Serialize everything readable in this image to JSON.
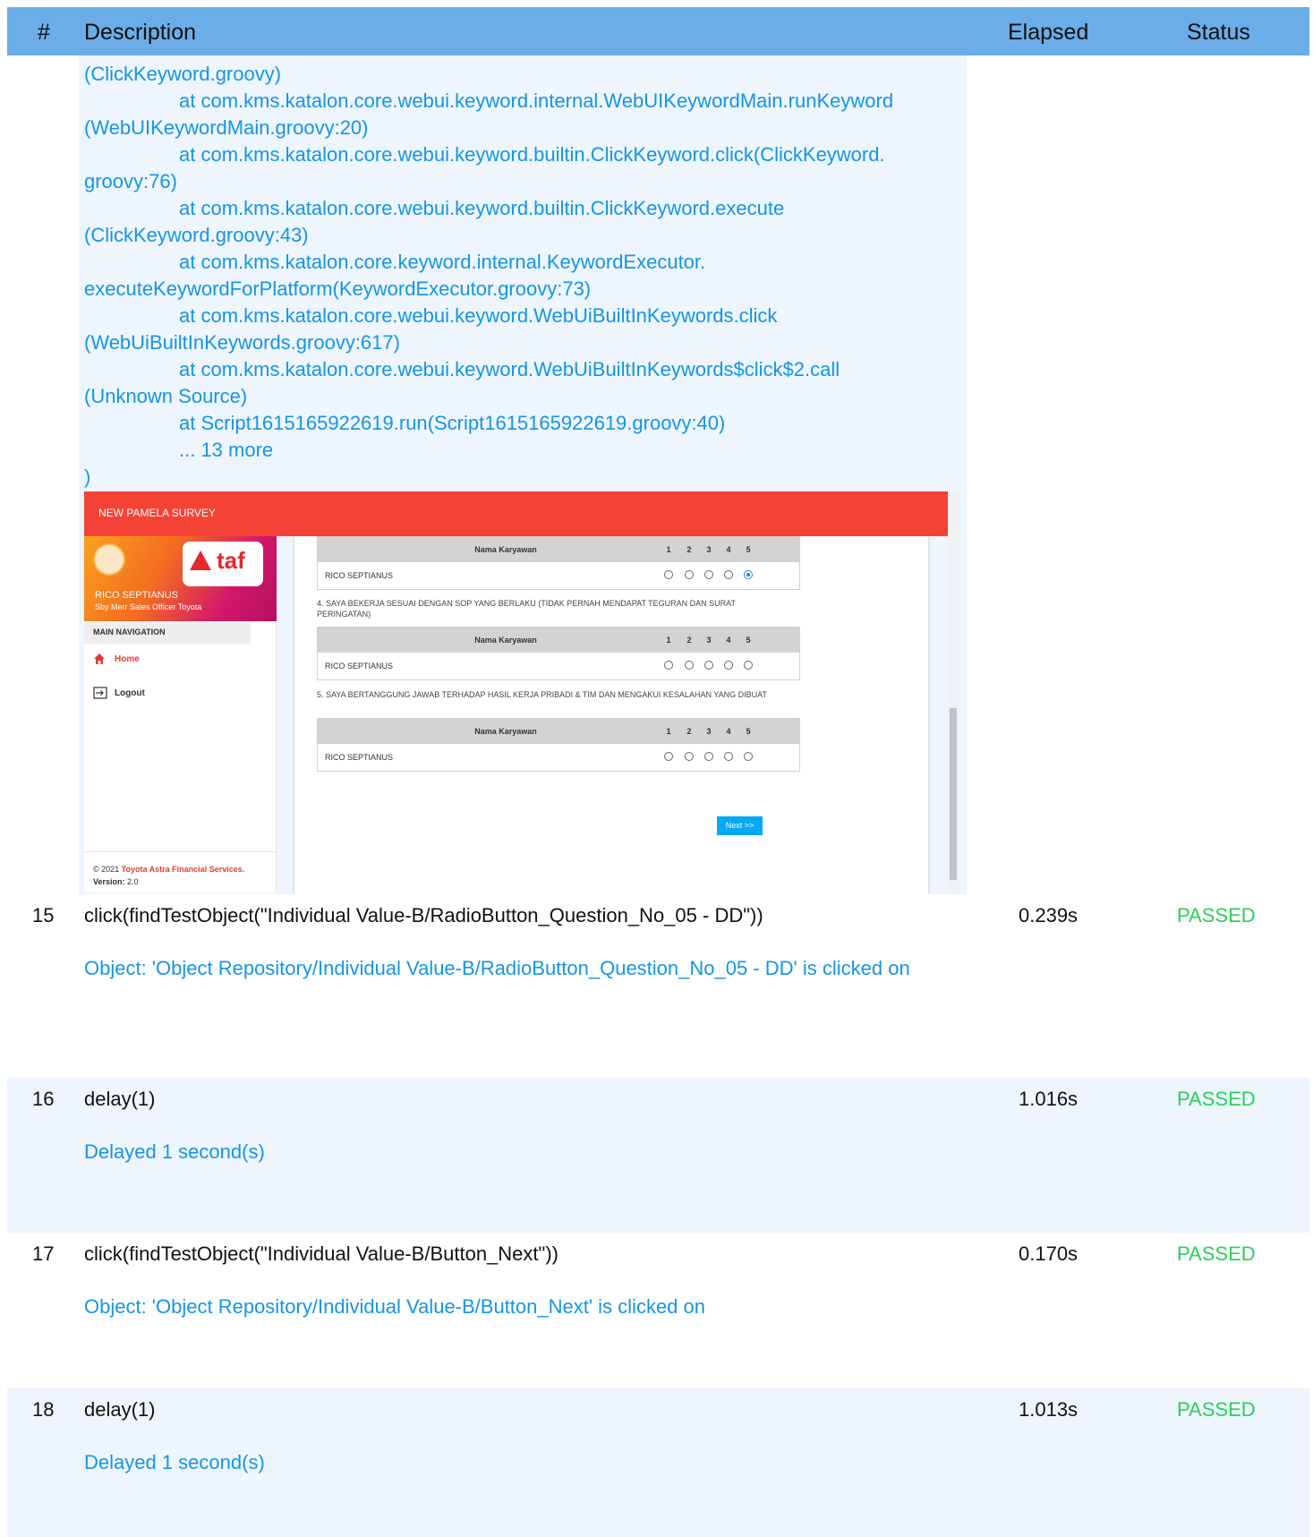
{
  "header": {
    "num": "#",
    "description": "Description",
    "elapsed": "Elapsed",
    "status": "Status"
  },
  "trace": {
    "lines": [
      {
        "text": "(ClickKeyword.groovy)",
        "indent": false
      },
      {
        "text": "at com.kms.katalon.core.webui.keyword.internal.WebUIKeywordMain.runKeyword",
        "indent": true
      },
      {
        "text": "(WebUIKeywordMain.groovy:20)",
        "indent": false
      },
      {
        "text": "at com.kms.katalon.core.webui.keyword.builtin.ClickKeyword.click(ClickKeyword.",
        "indent": true
      },
      {
        "text": "groovy:76)",
        "indent": false
      },
      {
        "text": "at com.kms.katalon.core.webui.keyword.builtin.ClickKeyword.execute",
        "indent": true
      },
      {
        "text": "(ClickKeyword.groovy:43)",
        "indent": false
      },
      {
        "text": "at com.kms.katalon.core.keyword.internal.KeywordExecutor.",
        "indent": true
      },
      {
        "text": "executeKeywordForPlatform(KeywordExecutor.groovy:73)",
        "indent": false
      },
      {
        "text": "at com.kms.katalon.core.webui.keyword.WebUiBuiltInKeywords.click",
        "indent": true
      },
      {
        "text": "(WebUiBuiltInKeywords.groovy:617)",
        "indent": false
      },
      {
        "text": "at com.kms.katalon.core.webui.keyword.WebUiBuiltInKeywords$click$2.call",
        "indent": true
      },
      {
        "text": "(Unknown Source)",
        "indent": false
      },
      {
        "text": "at Script1615165922619.run(Script1615165922619.groovy:40)",
        "indent": true
      },
      {
        "text": "... 13 more",
        "indent": true
      },
      {
        "text": ")",
        "indent": false
      }
    ]
  },
  "screenshot": {
    "title": "NEW PAMELA SURVEY",
    "logo_text": "taf",
    "user_name": "RICO SEPTIANUS",
    "user_role": "Sby Merr Sales Officer Toyota",
    "main_nav": "MAIN NAVIGATION",
    "nav_home": "Home",
    "nav_logout": "Logout",
    "footer_prefix": "© 2021",
    "footer_company": "Toyota Astra Financial Services.",
    "footer_version_label": "Version:",
    "footer_version": "2.0",
    "col_name": "Nama Karyawan",
    "scale": [
      "1",
      "2",
      "3",
      "4",
      "5"
    ],
    "employee": "RICO SEPTIANUS",
    "question_4": "4. SAYA BEKERJA SESUAI DENGAN SOP YANG BERLAKU (TIDAK PERNAH MENDAPAT TEGURAN DAN SURAT PERINGATAN)",
    "question_5": "5. SAYA BERTANGGUNG JAWAB TERHADAP HASIL KERJA PRIBADI & TIM DAN MENGAKUI KESALAHAN YANG DIBUAT",
    "table1_selected": 5,
    "next_button": "Next >>"
  },
  "steps": [
    {
      "num": "15",
      "command": "click(findTestObject(\"Individual Value-B/RadioButton_Question_No_05 - DD\"))",
      "elapsed": "0.239s",
      "status": "PASSED",
      "message": "Object: 'Object Repository/Individual Value-B/RadioButton_Question_No_05 - DD' is clicked on"
    },
    {
      "num": "16",
      "command": "delay(1)",
      "elapsed": "1.016s",
      "status": "PASSED",
      "message": "Delayed 1 second(s)"
    },
    {
      "num": "17",
      "command": "click(findTestObject(\"Individual Value-B/Button_Next\"))",
      "elapsed": "0.170s",
      "status": "PASSED",
      "message": "Object: 'Object Repository/Individual Value-B/Button_Next' is clicked on"
    },
    {
      "num": "18",
      "command": "delay(1)",
      "elapsed": "1.013s",
      "status": "PASSED",
      "message": "Delayed 1 second(s)"
    }
  ],
  "colors": {
    "header_bg": "#6aade8",
    "link_blue": "#1496e2",
    "passed_green": "#2bd05a",
    "survey_red": "#f44336"
  }
}
